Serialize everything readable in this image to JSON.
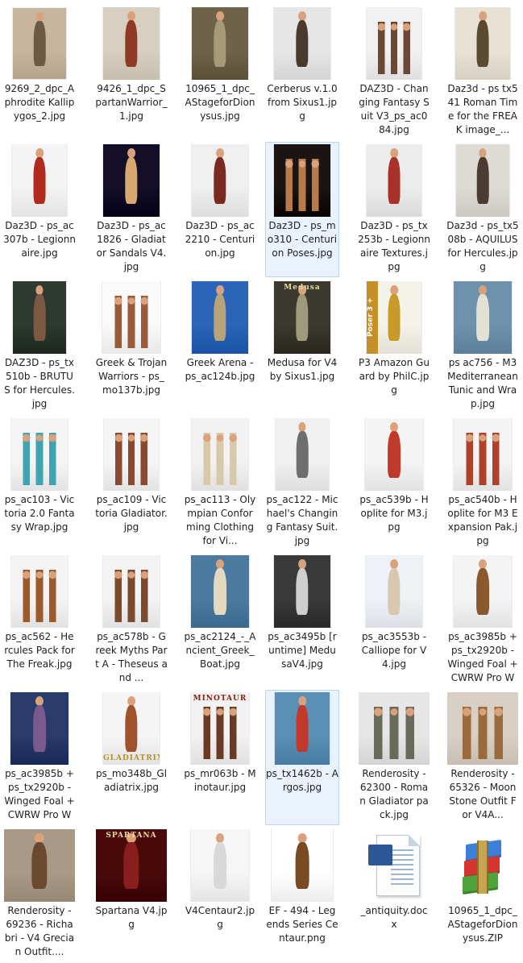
{
  "files": [
    {
      "name": "9269_2_dpc_Aphrodite Kallipygos_2.jpg",
      "icon": "image-thumbnail",
      "colors": [
        "#c7b59e",
        "#6b5a44"
      ]
    },
    {
      "name": "9426_1_dpc_SpartanWarrior_1.jpg",
      "icon": "image-thumbnail",
      "colors": [
        "#d8cfc0",
        "#8e3a24"
      ]
    },
    {
      "name": "10965_1_dpc_AStageforDionysus.jpg",
      "icon": "image-thumbnail",
      "colors": [
        "#6e6248",
        "#a79a78"
      ]
    },
    {
      "name": "Cerberus v.1.0 from Sixus1.jpg",
      "icon": "image-thumbnail",
      "colors": [
        "#e6e6e6",
        "#4a3a2e"
      ]
    },
    {
      "name": "DAZ3D - Changing Fantasy Suit V3_ps_ac084.jpg",
      "icon": "image-thumbnail",
      "colors": [
        "#f1f1f1",
        "#6a4736"
      ]
    },
    {
      "name": "Daz3d - ps tx541 Roman Time for the FREAK image_...",
      "icon": "image-thumbnail",
      "colors": [
        "#e8e2d4",
        "#5a4a30"
      ]
    },
    {
      "name": "Daz3D - ps_ac307b - Legionnaire.jpg",
      "icon": "image-thumbnail",
      "colors": [
        "#f4f4f4",
        "#b02a1e"
      ]
    },
    {
      "name": "Daz3D - ps_ac1826 - Gladiator Sandals V4.jpg",
      "icon": "image-thumbnail",
      "colors": [
        "#140e28",
        "#d7a870"
      ]
    },
    {
      "name": "Daz3D - ps_ac2210 - Centurion.jpg",
      "icon": "image-thumbnail",
      "colors": [
        "#efefef",
        "#7a2a20"
      ]
    },
    {
      "name": "Daz3D - ps_mo310 - Centurion Poses.jpg",
      "icon": "image-thumbnail",
      "colors": [
        "#1a1512",
        "#b87a4a"
      ]
    },
    {
      "name": "Daz3D - ps_tx253b - Legionnaire Textures.jpg",
      "icon": "image-thumbnail",
      "colors": [
        "#ececec",
        "#a8322a"
      ]
    },
    {
      "name": "Daz3d - ps_tx508b - AQUILUS for Hercules.jpg",
      "icon": "image-thumbnail",
      "colors": [
        "#dedbd6",
        "#4a3c32"
      ]
    },
    {
      "name": "DAZ3D - ps_tx510b - BRUTUS for Hercules.jpg",
      "icon": "image-thumbnail",
      "colors": [
        "#2e3a30",
        "#7a5a42"
      ]
    },
    {
      "name": "Greek & Trojan Warriors - ps_mo137b.jpg",
      "icon": "image-thumbnail",
      "colors": [
        "#fafafa",
        "#9a5a38"
      ]
    },
    {
      "name": "Greek Arena - ps_ac124b.jpg",
      "icon": "image-thumbnail",
      "colors": [
        "#2c64b8",
        "#b9a37a"
      ]
    },
    {
      "name": "Medusa for V4 by Sixus1.jpg",
      "icon": "image-thumbnail",
      "colors": [
        "#3c3a2e",
        "#9e9a7e"
      ]
    },
    {
      "name": "P3 Amazon Guard by PhilC.jpg",
      "icon": "image-thumbnail",
      "colors": [
        "#f5f2ea",
        "#c79a2a"
      ]
    },
    {
      "name": "ps ac756 - M3 Mediterranean Tunic and Wrap.jpg",
      "icon": "image-thumbnail",
      "colors": [
        "#6e92ac",
        "#e3e0d6"
      ]
    },
    {
      "name": "ps_ac103 - Victoria 2.0 Fantasy Wrap.jpg",
      "icon": "image-thumbnail",
      "colors": [
        "#f5f5f5",
        "#3fa3b0"
      ]
    },
    {
      "name": "ps_ac109 - Victoria Gladiator.jpg",
      "icon": "image-thumbnail",
      "colors": [
        "#f5f5f5",
        "#8a4a30"
      ]
    },
    {
      "name": "ps_ac113 - Olympian Conforming Clothing for Vi...",
      "icon": "image-thumbnail",
      "colors": [
        "#f2f2f2",
        "#d9c9a8"
      ]
    },
    {
      "name": "ps_ac122 - Michael's Changing Fantasy Suit.jpg",
      "icon": "image-thumbnail",
      "colors": [
        "#f0f0f0",
        "#6e6e6e"
      ]
    },
    {
      "name": "ps_ac539b - Hoplite for M3.jpg",
      "icon": "image-thumbnail",
      "colors": [
        "#f4f4f4",
        "#c03a2a"
      ]
    },
    {
      "name": "ps_ac540b - Hoplite for M3 Expansion Pak.jpg",
      "icon": "image-thumbnail",
      "colors": [
        "#f4f4f4",
        "#b0402a"
      ]
    },
    {
      "name": "ps_ac562 - Hercules Pack for The Freak.jpg",
      "icon": "image-thumbnail",
      "colors": [
        "#f4f4f4",
        "#9a5a2a"
      ]
    },
    {
      "name": "ps_ac578b - Greek Myths Part A - Theseus and ...",
      "icon": "image-thumbnail",
      "colors": [
        "#f3f3f3",
        "#7a4a2e"
      ]
    },
    {
      "name": "ps_ac2124_-_Ancient_Greek_Boat.jpg",
      "icon": "image-thumbnail",
      "colors": [
        "#4c7aa0",
        "#e3d9c0"
      ]
    },
    {
      "name": "ps_ac3495b [runtime] MedusaV4.jpg",
      "icon": "image-thumbnail",
      "colors": [
        "#3a3a3a",
        "#cfcfcf"
      ]
    },
    {
      "name": "ps_ac3553b - Calliope for V4.jpg",
      "icon": "image-thumbnail",
      "colors": [
        "#eef2f6",
        "#d8c8b0"
      ]
    },
    {
      "name": "ps_ac3985b + ps_tx2920b - Winged Foal + CWRW Pro Wi...",
      "icon": "image-thumbnail",
      "colors": [
        "#f4f4f4",
        "#8a5a2e"
      ]
    },
    {
      "name": "ps_ac3985b + ps_tx2920b - Winged Foal + CWRW Pro Wi...",
      "icon": "image-thumbnail",
      "colors": [
        "#2a3a6a",
        "#7a5a8e"
      ]
    },
    {
      "name": "ps_mo348b_Gladiatrix.jpg",
      "icon": "image-thumbnail",
      "colors": [
        "#f5f5f5",
        "#a0522d"
      ]
    },
    {
      "name": "ps_mr063b - Minotaur.jpg",
      "icon": "image-thumbnail",
      "colors": [
        "#f2f2f2",
        "#6a3a22"
      ]
    },
    {
      "name": "ps_tx1462b - Argos.jpg",
      "icon": "image-thumbnail",
      "colors": [
        "#5a8fb5",
        "#c0392b"
      ]
    },
    {
      "name": "Renderosity - 62300 - Roman Gladiator pack.jpg",
      "icon": "image-thumbnail",
      "colors": [
        "#e6e6e6",
        "#6a6a5a"
      ]
    },
    {
      "name": "Renderosity - 65326 - MoonStone Outfit For V4A...",
      "icon": "image-thumbnail",
      "colors": [
        "#d8d0c4",
        "#9a6a3a"
      ]
    },
    {
      "name": "Renderosity - 69236 - Richabri - V4 Grecian Outfit....",
      "icon": "image-thumbnail",
      "colors": [
        "#a89a86",
        "#6a4a2e"
      ]
    },
    {
      "name": "Spartana V4.jpg",
      "icon": "image-thumbnail",
      "colors": [
        "#4a0a0a",
        "#8a1e1e"
      ]
    },
    {
      "name": "V4Centaur2.jpg",
      "icon": "image-thumbnail",
      "colors": [
        "#f6f6f6",
        "#d8d8d8"
      ]
    },
    {
      "name": "EF - 494 - Legends Series Centaur.png",
      "icon": "image-thumbnail",
      "colors": [
        "#ffffff",
        "#7a4a22"
      ]
    },
    {
      "name": "_antiquity.docx",
      "icon": "word-document-icon",
      "colors": [
        "#ffffff",
        "#2b5797"
      ]
    },
    {
      "name": "10965_1_dpc_AStageforDionysus.ZIP",
      "icon": "winrar-archive-icon",
      "colors": [
        "#ffffff",
        "#c7a451"
      ]
    }
  ],
  "image_text": {
    "medusa_title": "Medusa",
    "poser_badge": "Poser 3 +",
    "minotaur_title": "MINOTAUR",
    "spartana_title": "SPARTANA",
    "gladiatrix_title": "GLADIATRIX",
    "word_letter": "W"
  },
  "selected_indexes": [
    9,
    33
  ]
}
